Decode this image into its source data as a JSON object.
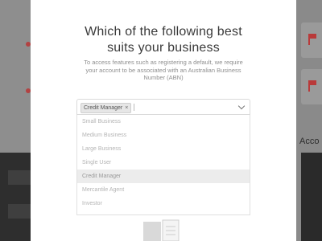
{
  "background": {
    "right_label": "Acco"
  },
  "modal": {
    "title_line1": "Which of the following best",
    "title_line2": "suits your business",
    "description": "To access features such as registering a default, we require your account to be associated with an Australian Business Number (ABN)",
    "select": {
      "selected_tag": "Credit Manager",
      "remove_symbol": "×",
      "options": [
        "Small Business",
        "Medium Business",
        "Large Business",
        "Single User",
        "Credit Manager",
        "Mercantile Agent",
        "Investor"
      ],
      "highlighted_option": "Credit Manager"
    }
  }
}
